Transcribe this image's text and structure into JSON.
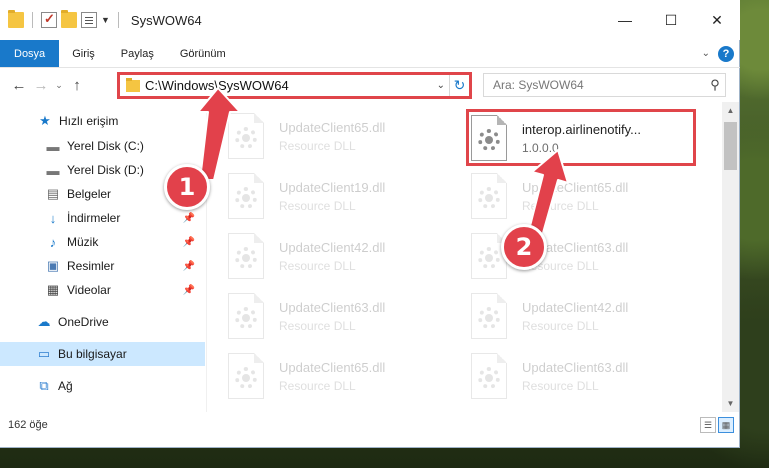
{
  "window": {
    "title": "SysWOW64",
    "controls": {
      "minimize": "—",
      "maximize": "☐",
      "close": "✕"
    }
  },
  "ribbon": {
    "tabs": [
      "Dosya",
      "Giriş",
      "Paylaş",
      "Görünüm"
    ]
  },
  "address": {
    "path": "C:\\Windows\\SysWOW64",
    "search_placeholder": "Ara: SysWOW64"
  },
  "navpane": {
    "items": [
      {
        "label": "Hızlı erişim",
        "icon": "star-icon"
      },
      {
        "label": "Yerel Disk (C:)",
        "icon": "drive-icon"
      },
      {
        "label": "Yerel Disk (D:)",
        "icon": "drive-icon"
      },
      {
        "label": "Belgeler",
        "icon": "documents-icon"
      },
      {
        "label": "İndirmeler",
        "icon": "download-icon"
      },
      {
        "label": "Müzik",
        "icon": "music-icon"
      },
      {
        "label": "Resimler",
        "icon": "pictures-icon"
      },
      {
        "label": "Videolar",
        "icon": "videos-icon"
      },
      {
        "label": "OneDrive",
        "icon": "cloud-icon"
      },
      {
        "label": "Bu bilgisayar",
        "icon": "computer-icon"
      },
      {
        "label": "Ağ",
        "icon": "network-icon"
      }
    ]
  },
  "files": {
    "left": [
      {
        "name": "UpdateClient65.dll",
        "desc": "Resource DLL"
      },
      {
        "name": "UpdateClient19.dll",
        "desc": "Resource DLL"
      },
      {
        "name": "UpdateClient42.dll",
        "desc": "Resource DLL"
      },
      {
        "name": "UpdateClient63.dll",
        "desc": "Resource DLL"
      },
      {
        "name": "UpdateClient65.dll",
        "desc": "Resource DLL"
      }
    ],
    "right": [
      {
        "name": "interop.airlinenotify...",
        "desc": "1.0.0.0"
      },
      {
        "name": "UpdateClient65.dll",
        "desc": "Resource DLL"
      },
      {
        "name": "UpdateClient63.dll",
        "desc": "Resource DLL"
      },
      {
        "name": "UpdateClient42.dll",
        "desc": "Resource DLL"
      },
      {
        "name": "UpdateClient63.dll",
        "desc": "Resource DLL"
      }
    ]
  },
  "status": {
    "item_count": "162 öğe"
  },
  "annotations": {
    "step1": "1",
    "step2": "2"
  },
  "colors": {
    "accent": "#1979ca",
    "annotation_red": "#e0454a",
    "selection": "#cce8ff"
  }
}
